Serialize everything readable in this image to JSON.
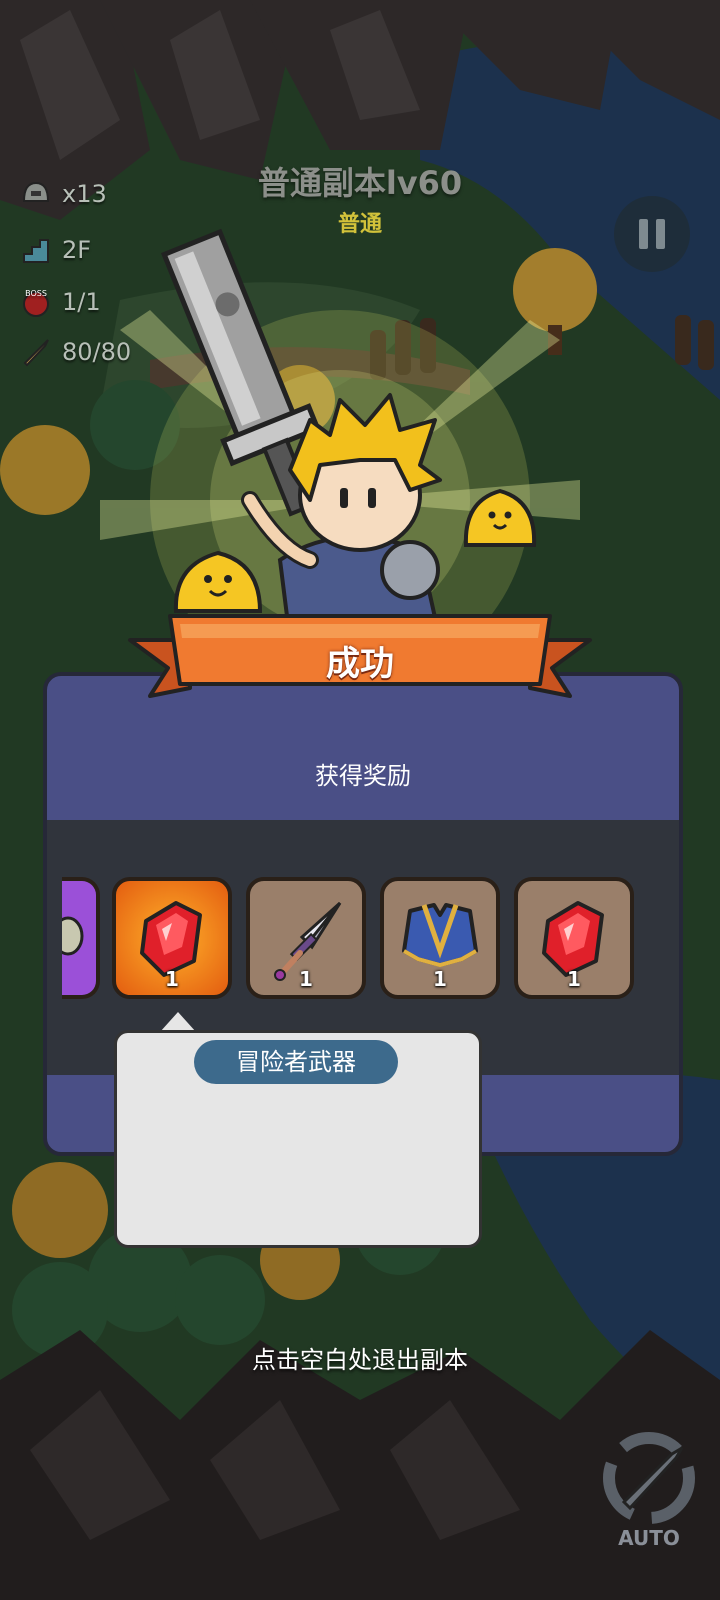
{
  "hud": {
    "helmet_count": "x13",
    "floor": "2F",
    "boss_count": "1/1",
    "boss_icon_text": "BOSS",
    "stamina": "80/80"
  },
  "stage": {
    "title": "普通副本lv60",
    "difficulty": "普通"
  },
  "result": {
    "banner": "成功",
    "reward_title": "获得奖励"
  },
  "rewards": [
    {
      "name": "partial-item",
      "quantity": ""
    },
    {
      "name": "red-gem",
      "quantity": "1"
    },
    {
      "name": "dagger",
      "quantity": "1"
    },
    {
      "name": "blue-armor",
      "quantity": "1"
    },
    {
      "name": "red-gem",
      "quantity": "1"
    }
  ],
  "tooltip": {
    "item_name": "冒险者武器"
  },
  "exit_hint": "点击空白处退出副本",
  "auto_button": "AUTO",
  "colors": {
    "panel": "#4a4f86",
    "ribbon": "#f07a30",
    "gold_text": "#d2c23a"
  }
}
